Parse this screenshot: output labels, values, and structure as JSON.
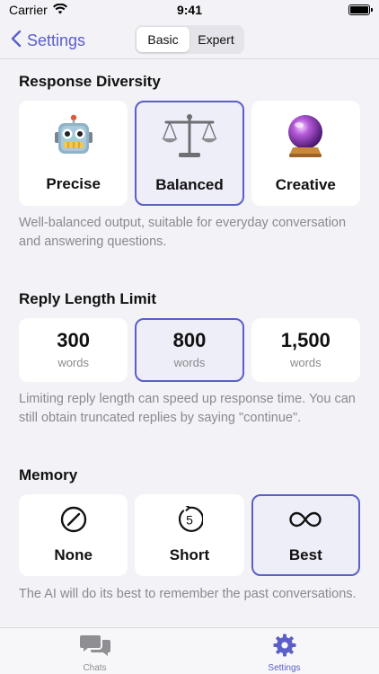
{
  "status": {
    "carrier": "Carrier",
    "time": "9:41"
  },
  "nav": {
    "back_label": "Settings",
    "segments": [
      {
        "label": "Basic"
      },
      {
        "label": "Expert"
      }
    ],
    "selected_segment": "Basic"
  },
  "diversity": {
    "title": "Response Diversity",
    "options": [
      {
        "label": "Precise",
        "icon": "robot-icon"
      },
      {
        "label": "Balanced",
        "icon": "scales-icon"
      },
      {
        "label": "Creative",
        "icon": "crystal-ball-icon"
      }
    ],
    "selected": "Balanced",
    "description": "Well-balanced output, suitable for everyday conversation and answering questions."
  },
  "reply_length": {
    "title": "Reply Length Limit",
    "options": [
      {
        "value": "300",
        "unit": "words"
      },
      {
        "value": "800",
        "unit": "words"
      },
      {
        "value": "1,500",
        "unit": "words"
      }
    ],
    "selected": "800",
    "description": "Limiting reply length can speed up response time. You can still obtain truncated replies by saying \"continue\"."
  },
  "memory": {
    "title": "Memory",
    "options": [
      {
        "label": "None",
        "icon": "prohibited-circle-icon"
      },
      {
        "label": "Short",
        "icon": "countdown-5-icon",
        "icon_text": "5"
      },
      {
        "label": "Best",
        "icon": "infinity-icon"
      }
    ],
    "selected": "Best",
    "description": "The AI will do its best to remember the past conversations."
  },
  "tabs": [
    {
      "label": "Chats",
      "icon": "chat-bubbles-icon",
      "active": false
    },
    {
      "label": "Settings",
      "icon": "gear-icon",
      "active": true
    }
  ],
  "colors": {
    "accent": "#5b5fc7",
    "background": "#f2f2f7",
    "secondary_text": "#8a8a8e",
    "inactive_tab": "#8e8e93"
  }
}
